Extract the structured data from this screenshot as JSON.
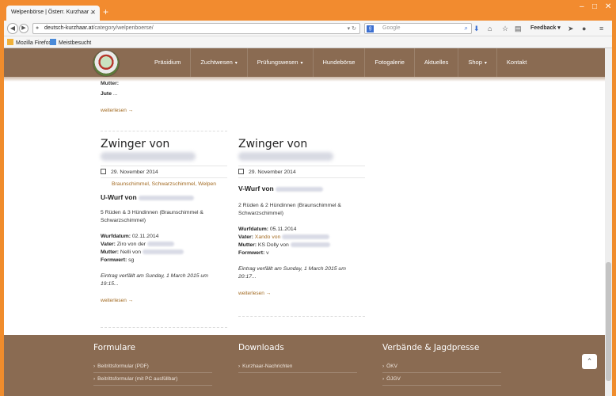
{
  "browser": {
    "tab_title": "Welpenbörse | Österr. Kurzhaar ...",
    "tab_close": "✕",
    "new_tab": "+",
    "url_domain": "deutsch-kurzhaar.at",
    "url_path": "/category/welpenboerse/",
    "search_placeholder": "Google",
    "feedback": "Feedback",
    "bookmarks": [
      "Mozilla Firefox",
      "Meistbesucht"
    ]
  },
  "site": {
    "menu": [
      {
        "label": "Präsidium",
        "caret": false
      },
      {
        "label": "Zuchtwesen",
        "caret": true
      },
      {
        "label": "Prüfungswesen",
        "caret": true
      },
      {
        "label": "Hundebörse",
        "caret": false
      },
      {
        "label": "Fotogalerie",
        "caret": false
      },
      {
        "label": "Aktuelles",
        "caret": false
      },
      {
        "label": "Shop",
        "caret": true
      },
      {
        "label": "Kontakt",
        "caret": false
      }
    ]
  },
  "previous_post": {
    "mutter_label": "Mutter:",
    "jute": "Jute",
    "ellipsis": "...",
    "read_more": "weiterlesen →"
  },
  "posts": [
    {
      "title": "Zwinger von",
      "date": "29. November 2014",
      "tags": "Braunschimmel, Schwarzschimmel, Welpen",
      "heading": "U-Wurf von",
      "litter": "5 Rüden & 3 Hündinnen (Braunschimmel & Schwarzschimmel)",
      "wurf_label": "Wurfdatum:",
      "wurf_value": "02.11.2014",
      "vater_label": "Vater:",
      "vater_value": "Ziro von der",
      "mutter_label": "Mutter:",
      "mutter_value": "Nelli von",
      "formwert_label": "Formwert:",
      "formwert_value": "sg",
      "expiry": "Eintrag verfällt am Sunday, 1 March 2015 um 19:15...",
      "read_more": "weiterlesen →"
    },
    {
      "title": "Zwinger von",
      "date": "29. November 2014",
      "heading": "V-Wurf von",
      "litter": "2 Rüden & 2 Hündinnen (Braunschimmel & Schwarzschimmel)",
      "wurf_label": "Wurfdatum:",
      "wurf_value": "05.11.2014",
      "vater_label": "Vater:",
      "vater_value": "Xando von",
      "mutter_label": "Mutter:",
      "mutter_value": "KS Dolly von",
      "formwert_label": "Formwert:",
      "formwert_value": "v",
      "expiry": "Eintrag verfällt am Sunday, 1 March 2015 um 20:17...",
      "read_more": "weiterlesen →"
    }
  ],
  "footer": {
    "columns": [
      {
        "title": "Formulare",
        "links": [
          "Beitrittsformular (PDF)",
          "Beitrittsformular (mit PC ausfüllbar)"
        ]
      },
      {
        "title": "Downloads",
        "links": [
          "Kurzhaar-Nachrichten"
        ]
      },
      {
        "title": "Verbände & Jagdpresse",
        "links": [
          "ÖKV",
          "ÖJGV"
        ]
      }
    ],
    "to_top": "⌃"
  }
}
